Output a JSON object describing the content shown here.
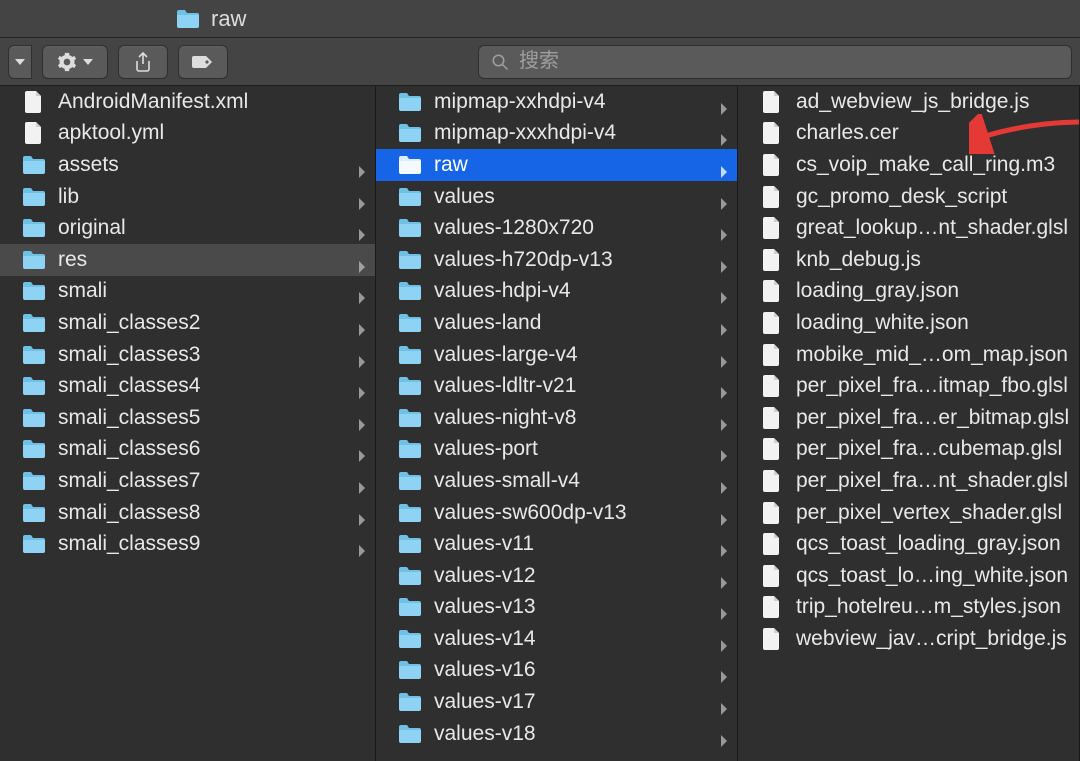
{
  "window": {
    "path_label": "raw"
  },
  "toolbar": {
    "search_placeholder": "搜索"
  },
  "columns": {
    "col1": [
      {
        "name": "AndroidManifest.xml",
        "type": "file"
      },
      {
        "name": "apktool.yml",
        "type": "file"
      },
      {
        "name": "assets",
        "type": "folder",
        "hasChildren": true
      },
      {
        "name": "lib",
        "type": "folder",
        "hasChildren": true
      },
      {
        "name": "original",
        "type": "folder",
        "hasChildren": true
      },
      {
        "name": "res",
        "type": "folder",
        "hasChildren": true,
        "selected": "path"
      },
      {
        "name": "smali",
        "type": "folder",
        "hasChildren": true
      },
      {
        "name": "smali_classes2",
        "type": "folder",
        "hasChildren": true
      },
      {
        "name": "smali_classes3",
        "type": "folder",
        "hasChildren": true
      },
      {
        "name": "smali_classes4",
        "type": "folder",
        "hasChildren": true
      },
      {
        "name": "smali_classes5",
        "type": "folder",
        "hasChildren": true
      },
      {
        "name": "smali_classes6",
        "type": "folder",
        "hasChildren": true
      },
      {
        "name": "smali_classes7",
        "type": "folder",
        "hasChildren": true
      },
      {
        "name": "smali_classes8",
        "type": "folder",
        "hasChildren": true
      },
      {
        "name": "smali_classes9",
        "type": "folder",
        "hasChildren": true
      }
    ],
    "col2": [
      {
        "name": "mipmap-xxhdpi-v4",
        "type": "folder",
        "hasChildren": true
      },
      {
        "name": "mipmap-xxxhdpi-v4",
        "type": "folder",
        "hasChildren": true
      },
      {
        "name": "raw",
        "type": "folder",
        "hasChildren": true,
        "selected": "active"
      },
      {
        "name": "values",
        "type": "folder",
        "hasChildren": true
      },
      {
        "name": "values-1280x720",
        "type": "folder",
        "hasChildren": true
      },
      {
        "name": "values-h720dp-v13",
        "type": "folder",
        "hasChildren": true
      },
      {
        "name": "values-hdpi-v4",
        "type": "folder",
        "hasChildren": true
      },
      {
        "name": "values-land",
        "type": "folder",
        "hasChildren": true
      },
      {
        "name": "values-large-v4",
        "type": "folder",
        "hasChildren": true
      },
      {
        "name": "values-ldltr-v21",
        "type": "folder",
        "hasChildren": true
      },
      {
        "name": "values-night-v8",
        "type": "folder",
        "hasChildren": true
      },
      {
        "name": "values-port",
        "type": "folder",
        "hasChildren": true
      },
      {
        "name": "values-small-v4",
        "type": "folder",
        "hasChildren": true
      },
      {
        "name": "values-sw600dp-v13",
        "type": "folder",
        "hasChildren": true
      },
      {
        "name": "values-v11",
        "type": "folder",
        "hasChildren": true
      },
      {
        "name": "values-v12",
        "type": "folder",
        "hasChildren": true
      },
      {
        "name": "values-v13",
        "type": "folder",
        "hasChildren": true
      },
      {
        "name": "values-v14",
        "type": "folder",
        "hasChildren": true
      },
      {
        "name": "values-v16",
        "type": "folder",
        "hasChildren": true
      },
      {
        "name": "values-v17",
        "type": "folder",
        "hasChildren": true
      },
      {
        "name": "values-v18",
        "type": "folder",
        "hasChildren": true
      }
    ],
    "col3": [
      {
        "name": "ad_webview_js_bridge.js",
        "type": "file"
      },
      {
        "name": "charles.cer",
        "type": "file",
        "annotated": true
      },
      {
        "name": "cs_voip_make_call_ring.m3",
        "type": "file"
      },
      {
        "name": "gc_promo_desk_script",
        "type": "file"
      },
      {
        "name": "great_lookup…nt_shader.glsl",
        "type": "file"
      },
      {
        "name": "knb_debug.js",
        "type": "file"
      },
      {
        "name": "loading_gray.json",
        "type": "file"
      },
      {
        "name": "loading_white.json",
        "type": "file"
      },
      {
        "name": "mobike_mid_…om_map.json",
        "type": "file"
      },
      {
        "name": "per_pixel_fra…itmap_fbo.glsl",
        "type": "file"
      },
      {
        "name": "per_pixel_fra…er_bitmap.glsl",
        "type": "file"
      },
      {
        "name": "per_pixel_fra…cubemap.glsl",
        "type": "file"
      },
      {
        "name": "per_pixel_fra…nt_shader.glsl",
        "type": "file"
      },
      {
        "name": "per_pixel_vertex_shader.glsl",
        "type": "file"
      },
      {
        "name": "qcs_toast_loading_gray.json",
        "type": "file"
      },
      {
        "name": "qcs_toast_lo…ing_white.json",
        "type": "file"
      },
      {
        "name": "trip_hotelreu…m_styles.json",
        "type": "file"
      },
      {
        "name": "webview_jav…cript_bridge.js",
        "type": "file"
      }
    ]
  }
}
